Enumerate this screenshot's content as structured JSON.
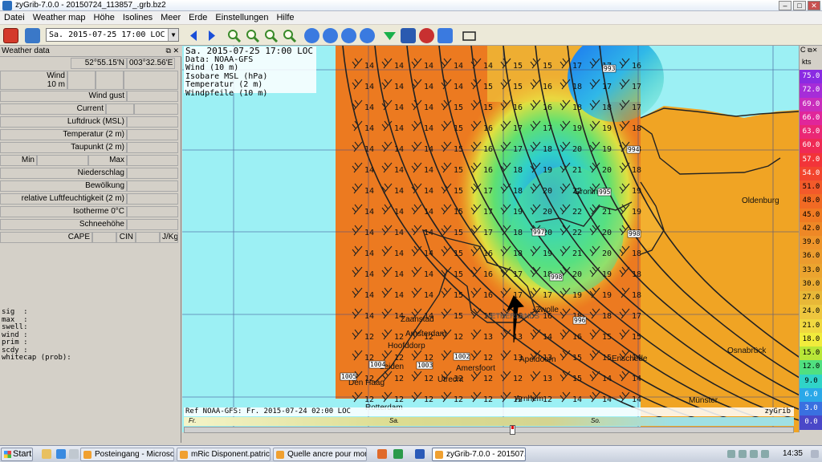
{
  "window": {
    "title": "zyGrib-7.0.0 - 20150724_113857_.grb.bz2"
  },
  "menu": [
    "Datei",
    "Weather map",
    "Höhe",
    "Isolines",
    "Meer",
    "Erde",
    "Einstellungen",
    "Hilfe"
  ],
  "toolbar": {
    "date_select": "Sa. 2015-07-25 17:00 LOC"
  },
  "weather_panel": {
    "title": "Weather data",
    "lat": "52°55.15'N",
    "lon": "003°32.56'E",
    "wind_label": "Wind",
    "wind_height": "10 m",
    "wind_gust": "Wind gust",
    "current": "Current",
    "pressure": "Luftdruck (MSL)",
    "temperature": "Temperatur (2 m)",
    "dewpoint": "Taupunkt (2 m)",
    "min": "Min",
    "max": "Max",
    "precip": "Niederschlag",
    "clouds": "Bewölkung",
    "humidity": "relative Luftfeuchtigkeit (2 m)",
    "isotherm": "Isotherme 0°C",
    "snow": "Schneehöhe",
    "cape": "CAPE",
    "cin": "CIN",
    "jkg": "J/Kg",
    "extra": "sig  :\nmax  :\nswell:\nwind :\nprim :\nscdy :\nwhitecap (prob):"
  },
  "map_info": {
    "line1": "Sa. 2015-07-25 17:00 LOC",
    "line2": "Data: NOAA-GFS",
    "line3": "Wind (10 m)",
    "line4": "Isobare MSL (hPa)",
    "line5": "Temperatur (2 m)",
    "line6": "Windpfeile (10 m)",
    "ref": "Ref NOAA-GFS: Fr. 2015-07-24 02:00 LOC",
    "brand": "zyGrib"
  },
  "cities": [
    {
      "name": "Oldenburg"
    },
    {
      "name": "Groningen"
    },
    {
      "name": "Zwolle"
    },
    {
      "name": "Osnabrück"
    },
    {
      "name": "Zaanstad"
    },
    {
      "name": "Amsterdam"
    },
    {
      "name": "Hoofddorp"
    },
    {
      "name": "Leiden"
    },
    {
      "name": "Den Haag"
    },
    {
      "name": "Utrecht"
    },
    {
      "name": "Amersfoort"
    },
    {
      "name": "Apeldoorn"
    },
    {
      "name": "Enschede"
    },
    {
      "name": "Arnhem"
    },
    {
      "name": "Rotterdam"
    },
    {
      "name": "Münster"
    },
    {
      "name": "NETHERLANDS"
    }
  ],
  "isobar_labels": [
    "993",
    "994",
    "995",
    "996",
    "997",
    "998",
    "998",
    "1002",
    "1003",
    "1004",
    "1005"
  ],
  "timeline": {
    "fr": "Fr.",
    "sa": "Sa.",
    "so": "So."
  },
  "colorbar": {
    "head": "C",
    "unit": "kts",
    "values": [
      "75.0",
      "72.0",
      "69.0",
      "66.0",
      "63.0",
      "60.0",
      "57.0",
      "54.0",
      "51.0",
      "48.0",
      "45.0",
      "42.0",
      "39.0",
      "36.0",
      "33.0",
      "30.0",
      "27.0",
      "24.0",
      "21.0",
      "18.0",
      "15.0",
      "12.0",
      "9.0",
      "6.0",
      "3.0",
      "0.0"
    ],
    "colors": [
      "#8a2be2",
      "#a62dd8",
      "#c92dbc",
      "#e0269a",
      "#ea2775",
      "#ef2a55",
      "#f23439",
      "#f2452e",
      "#f35a2a",
      "#f16a24",
      "#f07a22",
      "#ee8826",
      "#ee942a",
      "#ec9c2e",
      "#eba42f",
      "#ebab32",
      "#e8b838",
      "#eec63e",
      "#f0d840",
      "#f1ec3c",
      "#b8e638",
      "#50e080",
      "#30d4c8",
      "#2aa8e8",
      "#3a70e0",
      "#4a48c8"
    ]
  },
  "taskbar": {
    "start": "Start",
    "tasks": [
      "Posteingang - Microsoft ...",
      "mRic Disponent.patrick.d...",
      "Quelle ancre pour mon p...",
      "zyGrib-7.0.0 - 201507..."
    ],
    "clock": "14:35"
  }
}
